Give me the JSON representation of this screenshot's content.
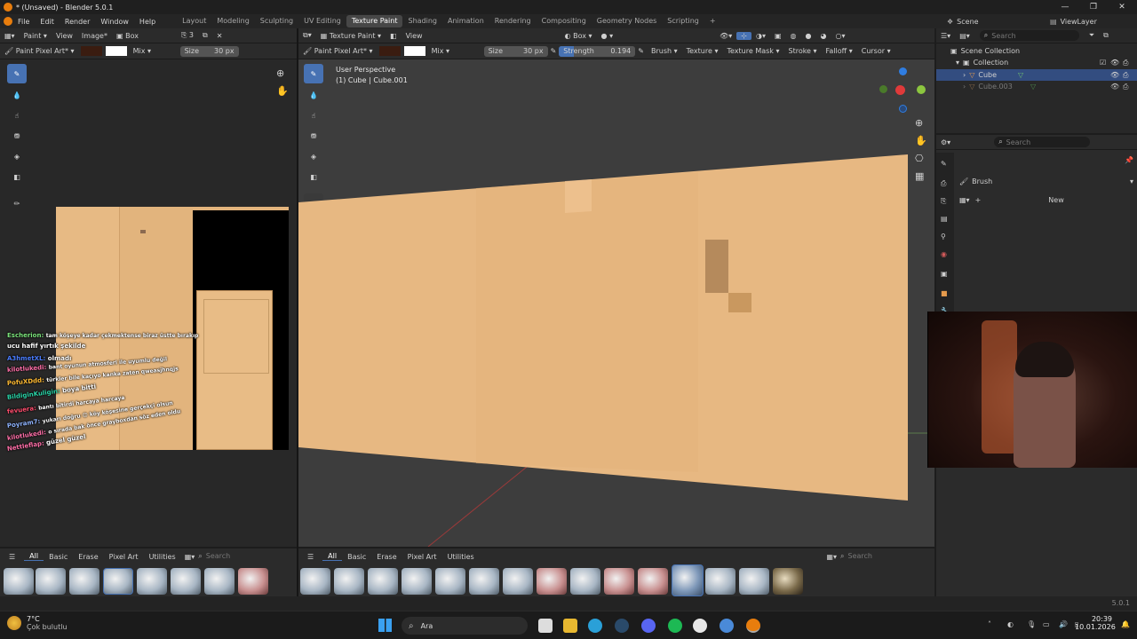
{
  "window": {
    "title": "* (Unsaved) - Blender 5.0.1"
  },
  "menu": {
    "items": [
      "File",
      "Edit",
      "Render",
      "Window",
      "Help"
    ]
  },
  "workspaces": [
    "Layout",
    "Modeling",
    "Sculpting",
    "UV Editing",
    "Texture Paint",
    "Shading",
    "Animation",
    "Rendering",
    "Compositing",
    "Geometry Nodes",
    "Scripting"
  ],
  "active_workspace": "Texture Paint",
  "scene": {
    "scene_label": "Scene",
    "viewlayer_label": "ViewLayer"
  },
  "image_editor": {
    "header": {
      "mode": "Paint",
      "view": "View",
      "image": "Image*",
      "box": "Box",
      "users": "3"
    },
    "tool_header": {
      "brush": "Paint Pixel Art*",
      "blend": "Mix",
      "size_label": "Size",
      "size_value": "30 px"
    }
  },
  "viewport": {
    "header": {
      "mode": "Texture Paint",
      "view": "View",
      "box": "Box"
    },
    "tool_header": {
      "brush": "Paint Pixel Art*",
      "blend": "Mix",
      "size_label": "Size",
      "size_value": "30 px",
      "strength_label": "Strength",
      "strength_value": "0.194",
      "menus": [
        "Brush",
        "Texture",
        "Texture Mask",
        "Stroke",
        "Falloff",
        "Cursor"
      ]
    },
    "overlay_text": {
      "perspective": "User Perspective",
      "object": "(1) Cube | Cube.001"
    }
  },
  "asset_shelf": {
    "tabs": [
      "All",
      "Basic",
      "Erase",
      "Pixel Art",
      "Utilities"
    ],
    "search_placeholder": "Search"
  },
  "outliner": {
    "search_placeholder": "Search",
    "rows": [
      {
        "label": "Scene Collection",
        "selected": false
      },
      {
        "label": "Collection",
        "selected": false
      },
      {
        "label": "Cube",
        "selected": true
      },
      {
        "label": "Cube.003",
        "selected": false
      }
    ]
  },
  "properties": {
    "search_placeholder": "Search",
    "panel": "Brush",
    "new_button": "New"
  },
  "status": {
    "version": "5.0.1"
  },
  "chat": [
    {
      "user": "Escherion:",
      "color": "#7be37b",
      "text": "tam köşeye kadar çekmektense biraz üstte bırakıp"
    },
    {
      "user": "",
      "color": "#ffffff",
      "text": "ucu hafif yırtık şekilde"
    },
    {
      "user": "A3hmetXL:",
      "color": "#4a7dff",
      "text": "olmadı"
    },
    {
      "user": "kilotlukedi:",
      "color": "#ff6fa8",
      "text": "bant oyunun atmosferi ile uyumlu değil"
    },
    {
      "user": "PofuXDdd:",
      "color": "#ffbb33",
      "text": "türkler bile kaçıyo kanka zaten qweasjhnqjs"
    },
    {
      "user": "BildiginKuligin:",
      "color": "#29d3a7",
      "text": "boya bitti"
    },
    {
      "user": "fevuera:",
      "color": "#ff4d6d",
      "text": "bantı bitirdi harcaya harcaya"
    },
    {
      "user": "Poyram7:",
      "color": "#8fb4ff",
      "text": "yukarı doğru 😊 köy köşesine gerçekçi olsun"
    },
    {
      "user": "kilotlukedi:",
      "color": "#ff6fa8",
      "text": "o sırada bak önce grayboxdan söz eden oldu"
    },
    {
      "user": "Nettleflap:",
      "color": "#ff6fa8",
      "text": "güzel güzel"
    }
  ],
  "taskbar": {
    "weather_temp": "7°C",
    "weather_desc": "Çok bulutlu",
    "search_label": "Ara",
    "time": "20:39",
    "date": "10.01.2026"
  },
  "colors": {
    "accent": "#4772b3",
    "wood": "#e6b67e",
    "bg": "#1d1d1d"
  }
}
